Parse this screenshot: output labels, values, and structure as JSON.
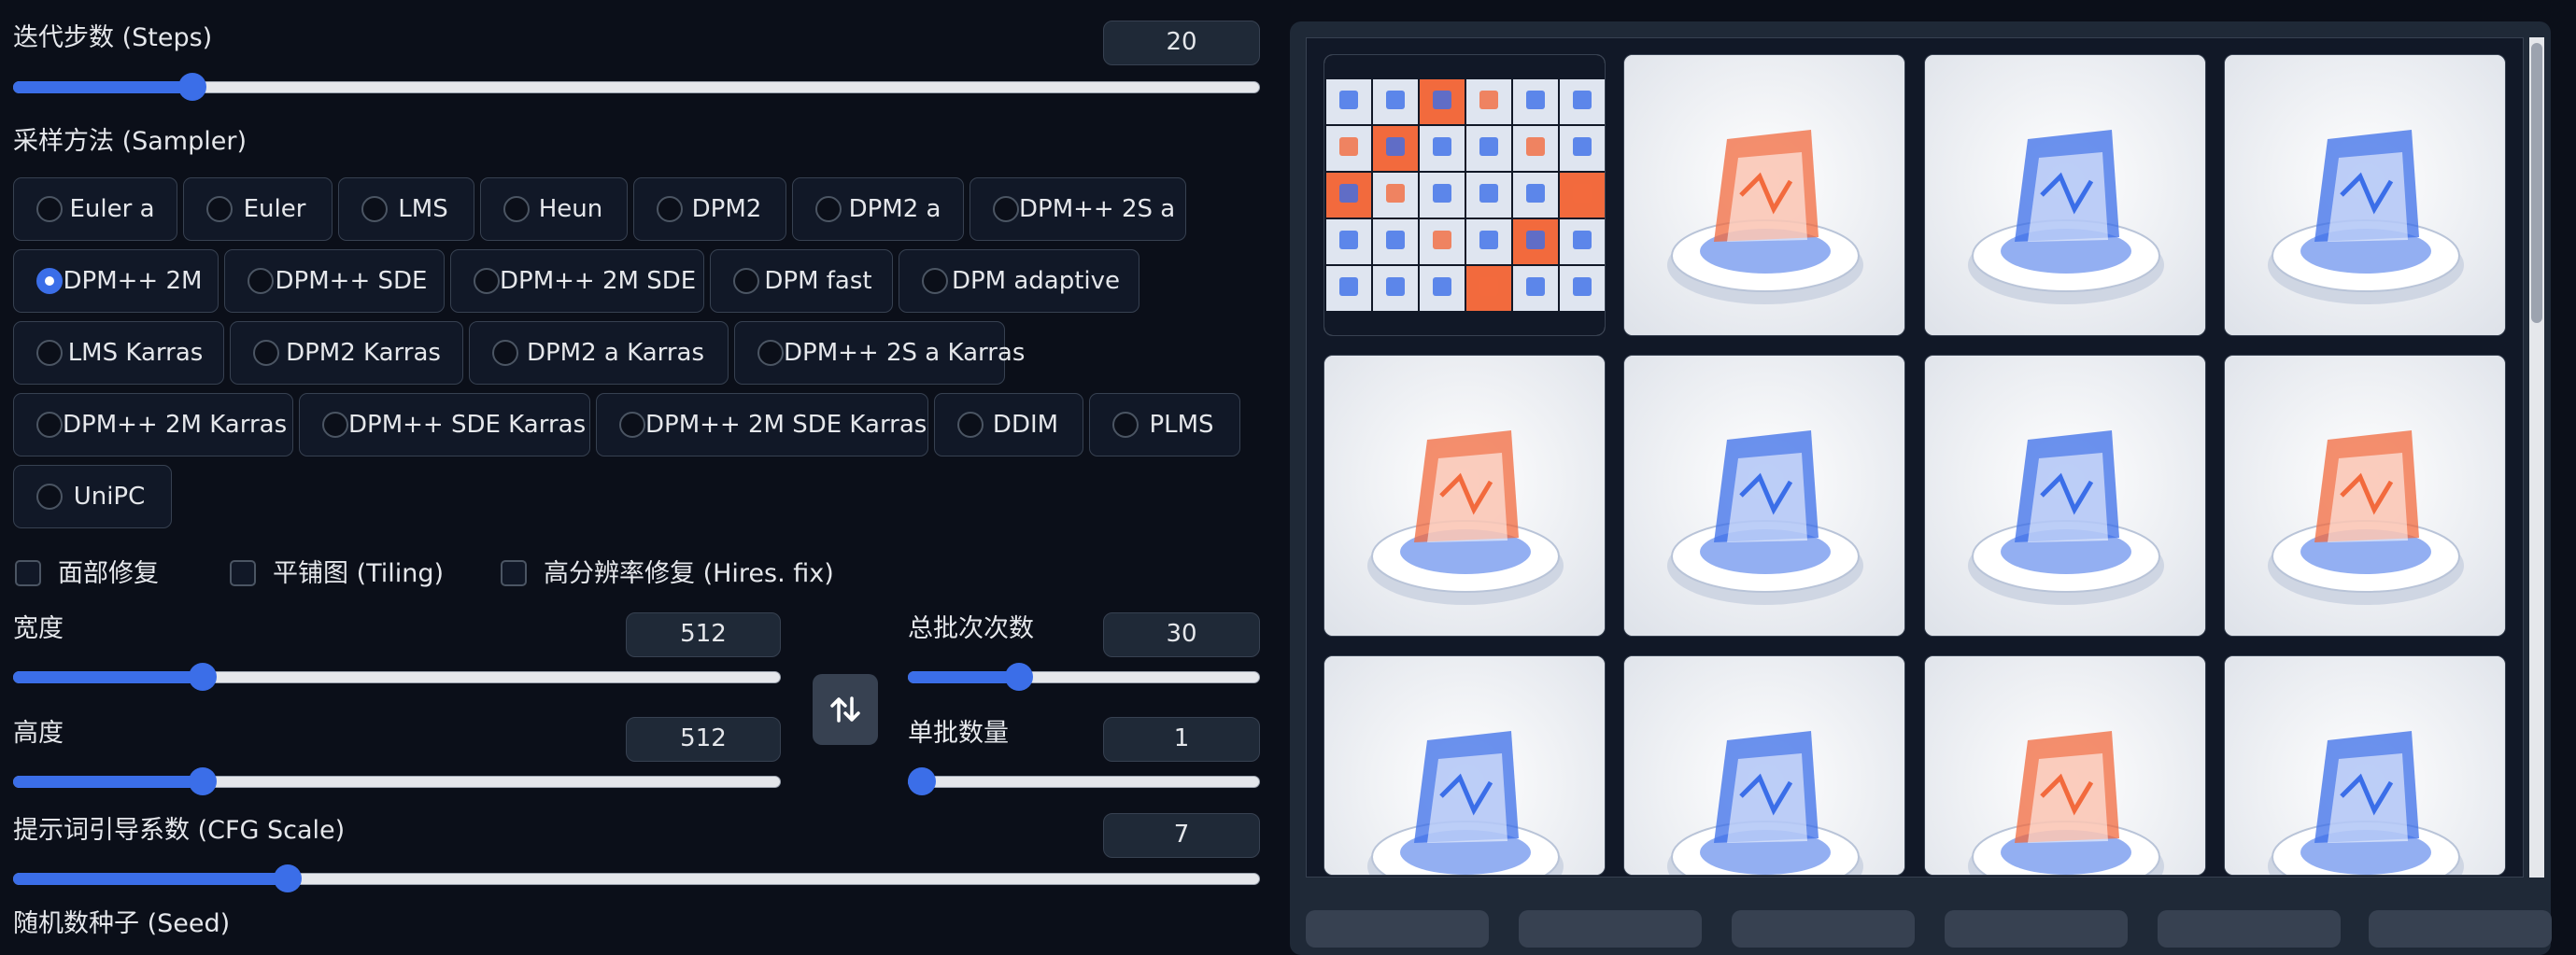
{
  "steps": {
    "label": "迭代步数 (Steps)",
    "value": "20",
    "level": 0.136
  },
  "sampler": {
    "label": "采样方法 (Sampler)",
    "selected": "DPM++ 2M",
    "rows": [
      [
        "Euler a",
        "Euler",
        "LMS",
        "Heun",
        "DPM2",
        "DPM2 a",
        "DPM++ 2S a"
      ],
      [
        "DPM++ 2M",
        "DPM++ SDE",
        "DPM++ 2M SDE",
        "DPM fast",
        "DPM adaptive"
      ],
      [
        "LMS Karras",
        "DPM2 Karras",
        "DPM2 a Karras",
        "DPM++ 2S a Karras"
      ],
      [
        "DPM++ 2M Karras",
        "DPM++ SDE Karras",
        "DPM++ 2M SDE Karras",
        "DDIM",
        "PLMS"
      ],
      [
        "UniPC"
      ]
    ]
  },
  "options": {
    "face_restore": "面部修复",
    "tiling": "平铺图 (Tiling)",
    "hires_fix": "高分辨率修复 (Hires. fix)"
  },
  "width": {
    "label": "宽度",
    "value": "512",
    "level": 0.238
  },
  "height": {
    "label": "高度",
    "value": "512",
    "level": 0.238
  },
  "batch_count": {
    "label": "总批次次数",
    "value": "30",
    "level": 0.3
  },
  "batch_size": {
    "label": "单批数量",
    "value": "1",
    "level": 0.0
  },
  "cfg": {
    "label": "提示词引导系数 (CFG Scale)",
    "value": "7",
    "level": 0.214
  },
  "seed": {
    "label": "随机数种子 (Seed)"
  },
  "swap_icon": "swap-vertical-icon",
  "colors": {
    "accent": "#3b6ee8",
    "bg": "#0b0f19",
    "panel": "#1f2937",
    "orange": "#f26a3d"
  }
}
